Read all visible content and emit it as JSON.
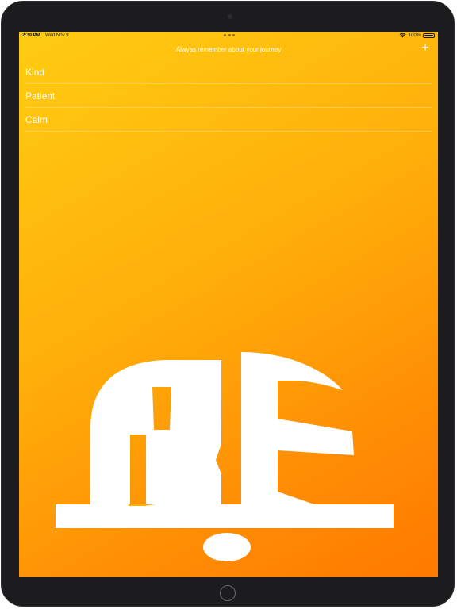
{
  "status_bar": {
    "time": "2:39 PM",
    "date": "Wed Nov 9",
    "battery": "100%"
  },
  "nav": {
    "title": "Alwyas remember about your journey",
    "add_label": "+"
  },
  "list": {
    "items": [
      {
        "label": "Kind"
      },
      {
        "label": "Patient"
      },
      {
        "label": "Calm"
      }
    ]
  },
  "logo": {
    "name": "BE",
    "color": "#ffffff"
  },
  "colors": {
    "gradient_start": "#ffcc12",
    "gradient_end": "#ff7a00",
    "text": "#ffffff",
    "bezel": "#1c1c1e"
  }
}
